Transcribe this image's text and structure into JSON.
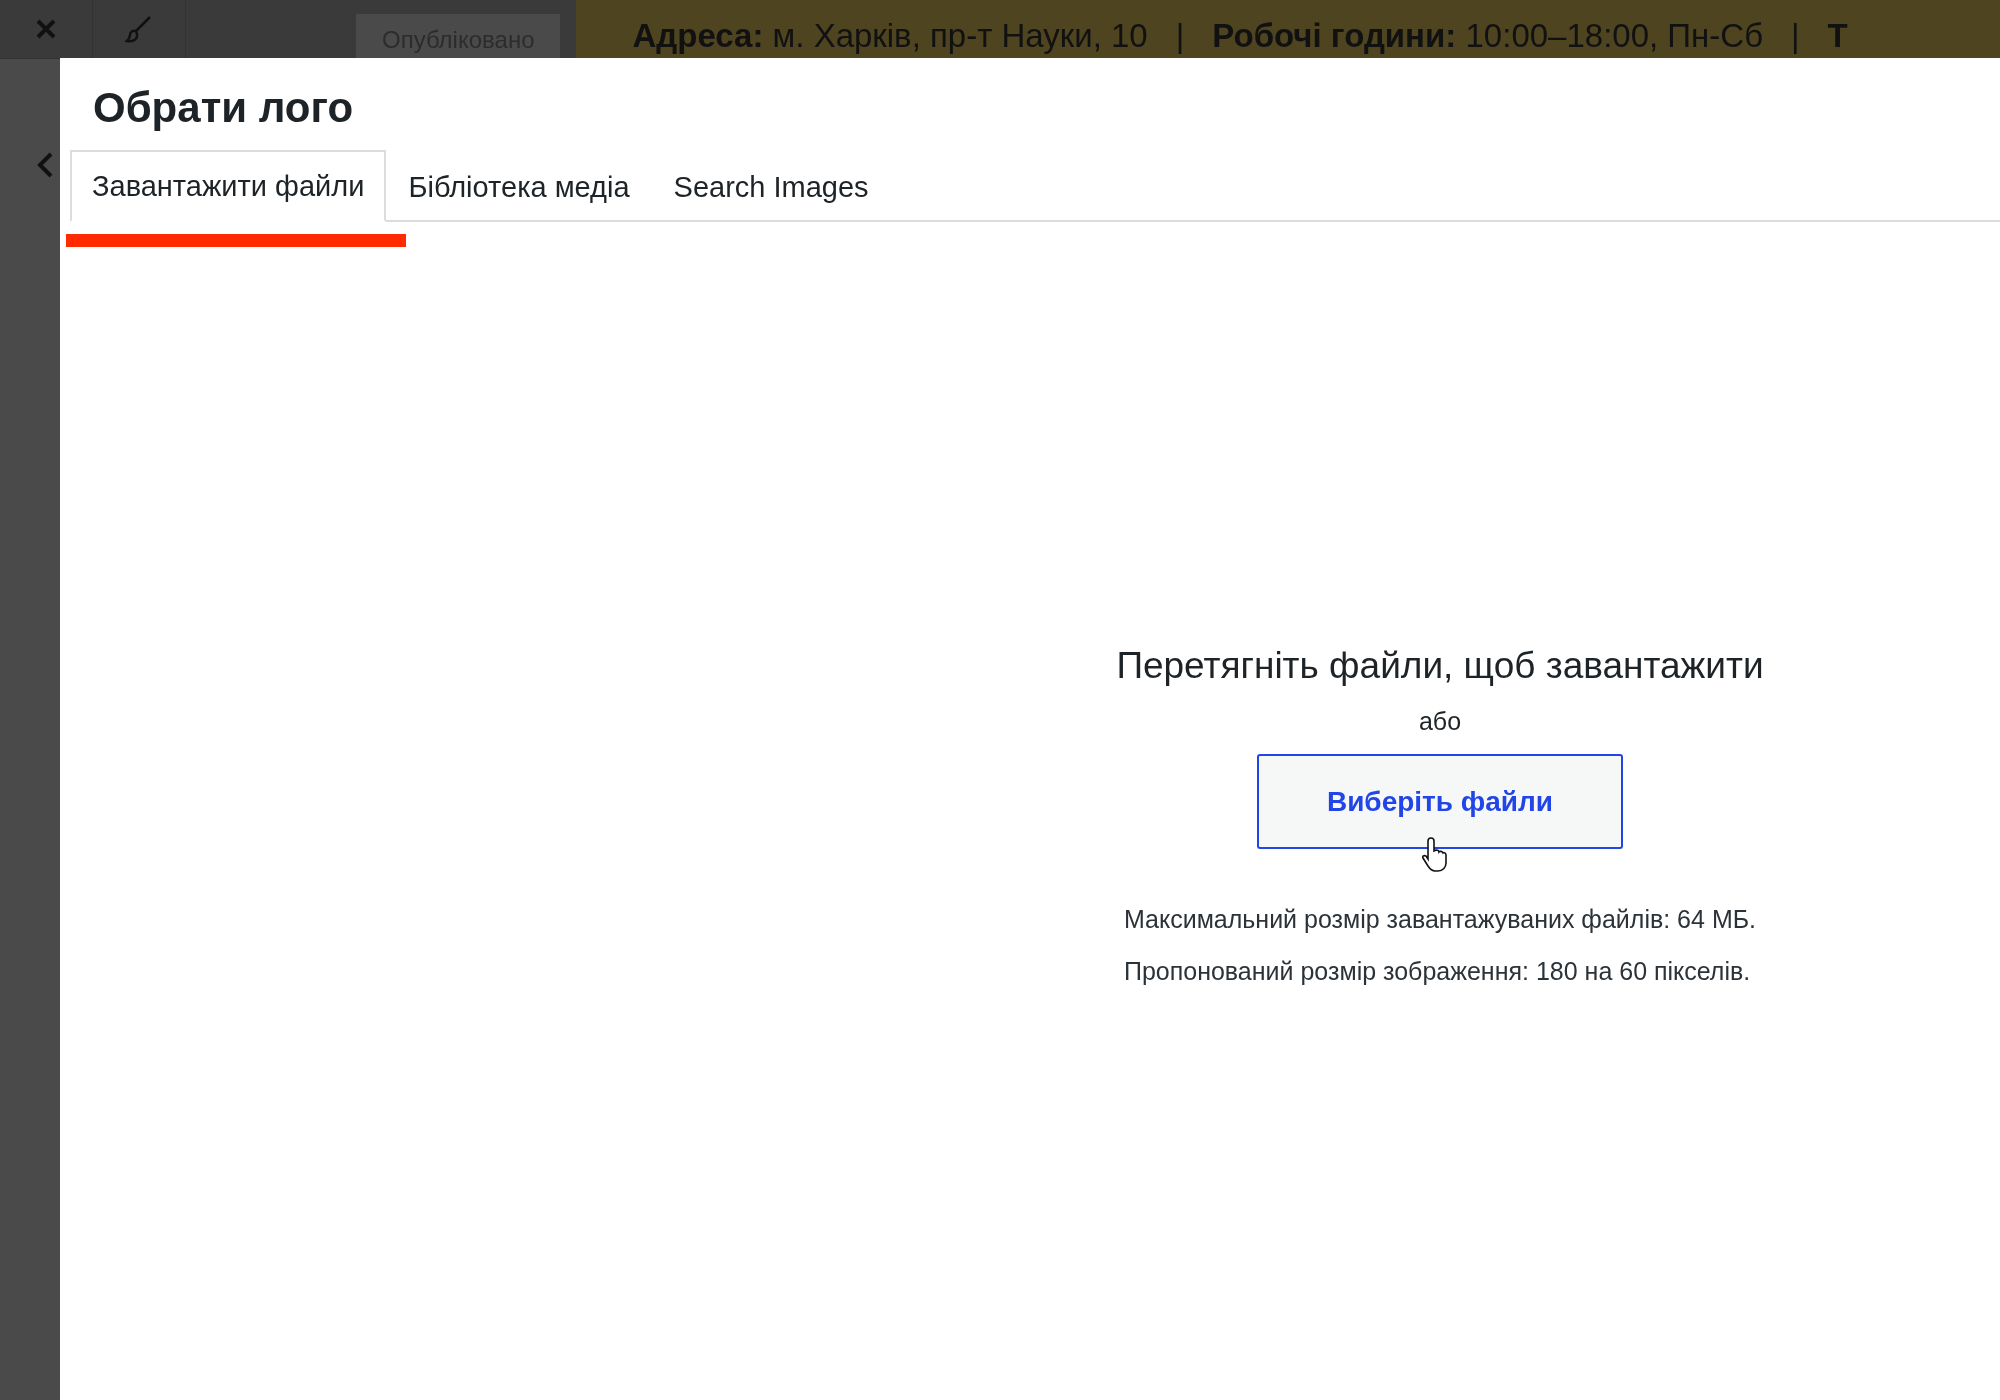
{
  "top_bar": {
    "publish_button": "Опубліковано",
    "info": [
      {
        "label": "Адреса:",
        "value": "м. Харків, пр-т Науки, 10"
      },
      {
        "label": "Робочі години:",
        "value": "10:00–18:00, Пн-Сб"
      },
      {
        "label": "Т"
      }
    ],
    "separator": "|"
  },
  "modal": {
    "title": "Обрати лого",
    "tabs": [
      {
        "label": "Завантажити файли",
        "selected": true
      },
      {
        "label": "Бібліотека медіа",
        "selected": false
      },
      {
        "label": "Search Images",
        "selected": false
      }
    ],
    "upload": {
      "instructions": "Перетягніть файли, щоб завантажити",
      "or": "або",
      "button": "Виберіть файли",
      "notes": [
        "Максимальний розмір завантажуваних файлів: 64 МБ.",
        "Пропонований розмір зображення: 180 на 60 пікселів."
      ]
    }
  }
}
